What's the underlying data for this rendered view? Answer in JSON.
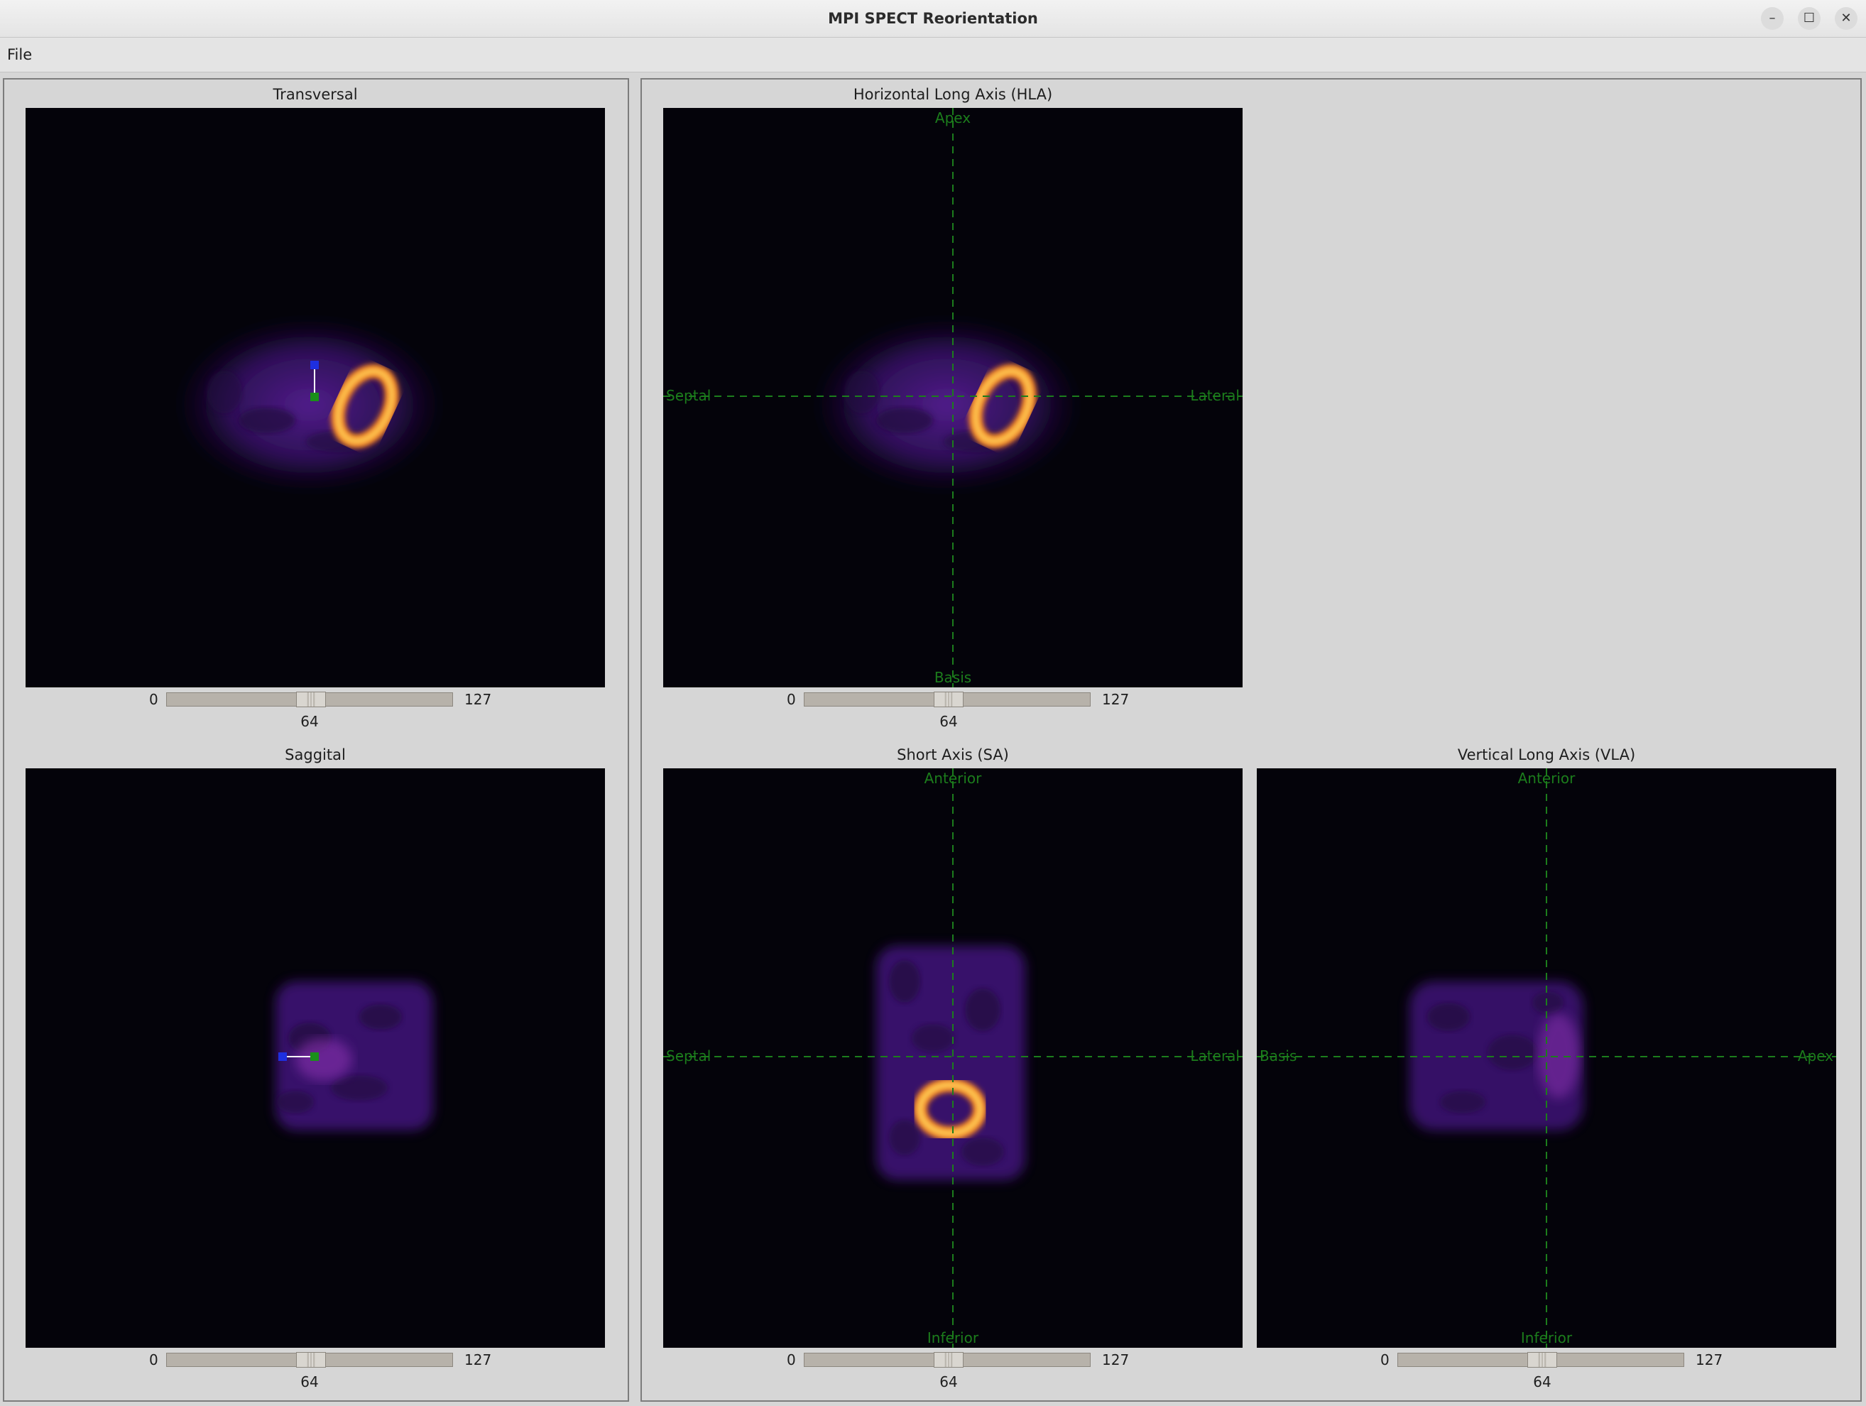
{
  "window": {
    "title": "MPI SPECT Reorientation"
  },
  "window_controls": {
    "minimize": "–",
    "maximize": "☐",
    "close": "✕"
  },
  "menu": {
    "file": "File"
  },
  "views": {
    "transversal": {
      "title": "Transversal",
      "slider": {
        "min": "0",
        "max": "127",
        "value": "64"
      }
    },
    "saggital": {
      "title": "Saggital",
      "slider": {
        "min": "0",
        "max": "127",
        "value": "64"
      }
    },
    "hla": {
      "title": "Horizontal Long Axis (HLA)",
      "labels": {
        "top": "Apex",
        "bottom": "Basis",
        "left": "Septal",
        "right": "Lateral"
      },
      "slider": {
        "min": "0",
        "max": "127",
        "value": "64"
      }
    },
    "sa": {
      "title": "Short Axis (SA)",
      "labels": {
        "top": "Anterior",
        "bottom": "Inferior",
        "left": "Septal",
        "right": "Lateral"
      },
      "slider": {
        "min": "0",
        "max": "127",
        "value": "64"
      }
    },
    "vla": {
      "title": "Vertical Long Axis (VLA)",
      "labels": {
        "top": "Anterior",
        "bottom": "Inferior",
        "left": "Basis",
        "right": "Apex"
      },
      "slider": {
        "min": "0",
        "max": "127",
        "value": "64"
      }
    }
  },
  "colors": {
    "overlay_line": "#1c7d1c",
    "marker_blue": "#1e2fe0",
    "marker_green": "#1a8f1a",
    "image_background": "#04030a"
  }
}
